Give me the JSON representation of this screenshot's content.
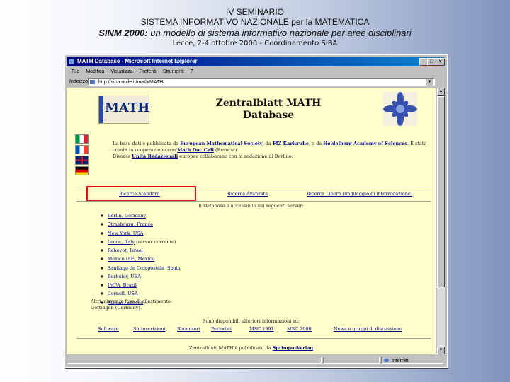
{
  "slide": {
    "line1": "IV SEMINARIO",
    "line2": "SISTEMA INFORMATIVO NAZIONALE per la MATEMATICA",
    "line3_bold": "SINM 2000:",
    "line3_rest": " un modello di sistema informativo nazionale per aree disciplinari",
    "line4": "Lecce, 2-4 ottobre 2000 - Coordinamento SIBA"
  },
  "browser": {
    "title": "MATH Database - Microsoft Internet Explorer",
    "menu": [
      "File",
      "Modifica",
      "Visualizza",
      "Preferiti",
      "Strumenti",
      "?"
    ],
    "address_label": "Indirizzo",
    "address_value": "http://siba.unile.it/math/MATH/"
  },
  "page": {
    "logo_text": "MATH",
    "title_line1": "Zentralblatt MATH",
    "title_line2": "Database",
    "intro_1": "La base dati è pubblicata da ",
    "intro_ems": "European Mathematical Society",
    "intro_2": ", da ",
    "intro_fiz": "FIZ Karlsruhe",
    "intro_3": ", e da ",
    "intro_hab": "Heidelberg Academy of Sciences",
    "intro_4": ". È stata creata in cooperazione con ",
    "intro_mdc": "Math Doc Cell",
    "intro_5": " (Francia).",
    "intro_6": "Diverse ",
    "intro_units": "Unità Redazionali",
    "intro_7": " europee collaborano con la redazione di Berlino.",
    "search_links": [
      "Ricerca Standard",
      "Ricerca Avanzata",
      "Ricerca Libera (linguaggio di interrogazione)"
    ],
    "available": "Il Database è accessibile sui seguenti server:",
    "servers": [
      {
        "t": "Berlin, Germany",
        "p": ""
      },
      {
        "t": "Strasbourg, France",
        "p": ""
      },
      {
        "t": "New York, USA",
        "p": ""
      },
      {
        "t": "Lecce, Italy",
        "p": " (server corrente)"
      },
      {
        "t": "Rehovot, Israel",
        "p": ""
      },
      {
        "t": "Mexico D.F., Mexico",
        "p": ""
      },
      {
        "t": "Santiago de Compostela, Spain",
        "p": ""
      },
      {
        "t": "Berkeley, USA",
        "p": ""
      },
      {
        "t": "IMPA, Brazil",
        "p": ""
      },
      {
        "t": "Cornell, USA",
        "p": ""
      },
      {
        "t": "Athens, Greece",
        "p": ""
      }
    ],
    "mirrors_line1": "Altri mirror in fase di allestimento:",
    "mirrors_line2": "Göttingen (Germany).",
    "more": "Sono disponibili ulteriori informazioni su:",
    "bottom_links": [
      "Software",
      "Sottoscrizioni",
      "Recensori",
      "Periodici",
      "MSC 1991",
      "MSC 2000",
      "News e gruppi di discussione"
    ],
    "publisher_text": "Zentralblatt MATH è pubblicato da ",
    "publisher_link": "Springer-Verlag",
    "status_right": "Internet"
  },
  "colors": {
    "content_bg": "#ffffcc",
    "link": "#00008b",
    "highlight": "#e01010"
  }
}
